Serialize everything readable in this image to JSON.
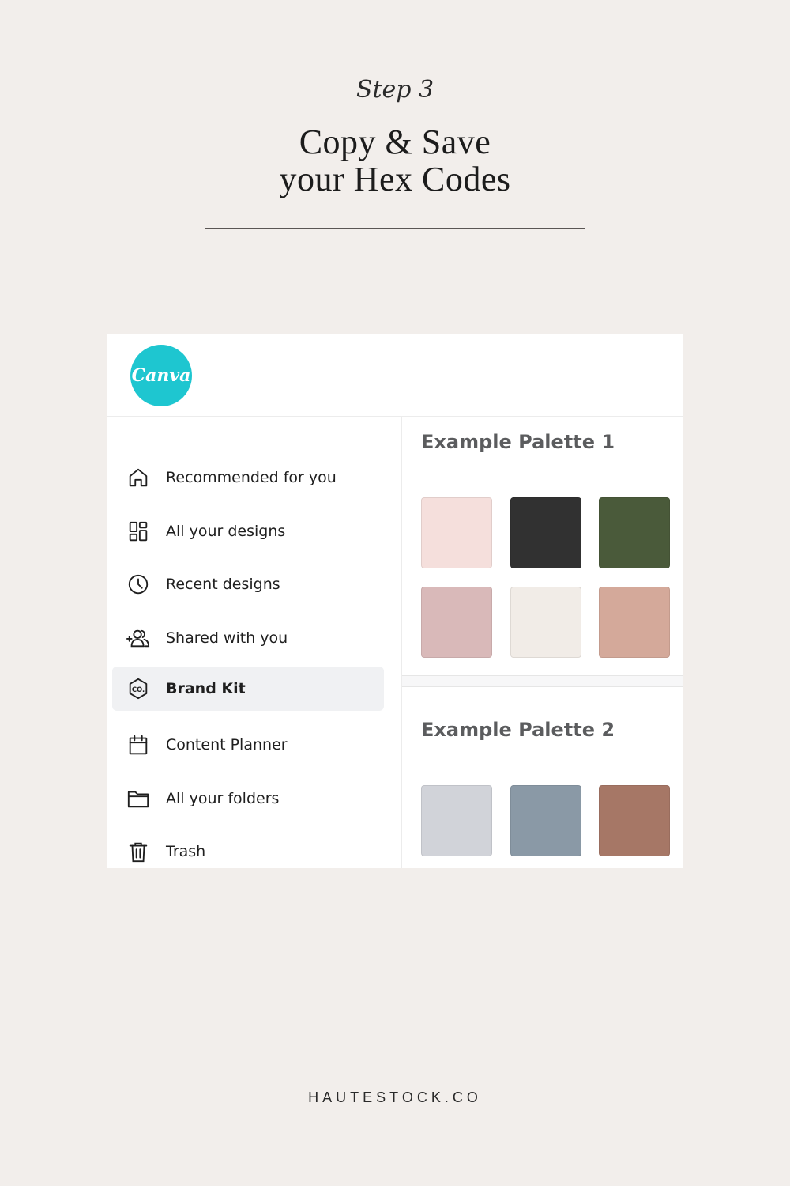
{
  "header": {
    "step": "Step 3",
    "title_line1": "Copy & Save",
    "title_line2": "your Hex Codes"
  },
  "app": {
    "logo_text": "Canva",
    "logo_color": "#1ec6d0"
  },
  "sidebar": {
    "items": [
      {
        "label": "Recommended for you",
        "icon": "home-icon"
      },
      {
        "label": "All your designs",
        "icon": "grid-icon"
      },
      {
        "label": "Recent designs",
        "icon": "clock-icon"
      },
      {
        "label": "Shared with you",
        "icon": "shared-users-icon"
      },
      {
        "label": "Brand Kit",
        "icon": "brand-kit-icon",
        "active": true
      },
      {
        "label": "Content Planner",
        "icon": "calendar-icon"
      },
      {
        "label": "All your folders",
        "icon": "folder-icon"
      },
      {
        "label": "Trash",
        "icon": "trash-icon"
      }
    ]
  },
  "palettes": [
    {
      "title": "Example Palette 1",
      "colors": [
        "#f5dfdc",
        "#313131",
        "#4a5a3a",
        "#d9b9b9",
        "#f1ece7",
        "#d4a99a"
      ]
    },
    {
      "title": "Example Palette 2",
      "colors": [
        "#d1d3d9",
        "#8a99a6",
        "#a67766"
      ]
    }
  ],
  "footer": {
    "brand": "HAUTESTOCK.CO"
  }
}
